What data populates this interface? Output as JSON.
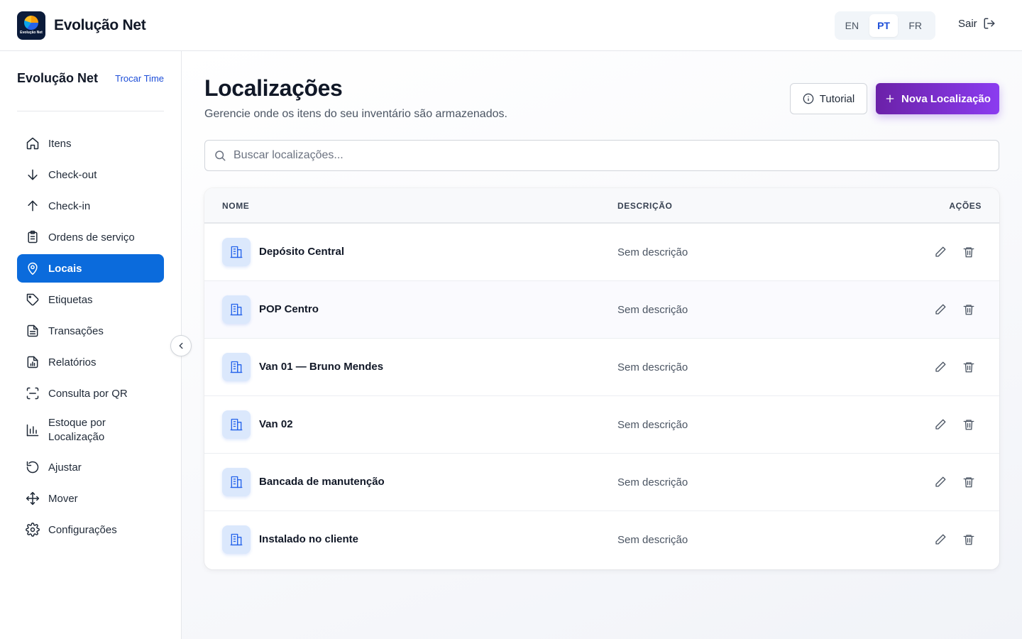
{
  "header": {
    "brand_name": "Evolução Net",
    "logo_text": "Evolução Net",
    "languages": [
      "EN",
      "PT",
      "FR"
    ],
    "active_language": "PT",
    "logout_label": "Sair"
  },
  "sidebar": {
    "team_name": "Evolução Net",
    "switch_team_label": "Trocar Time",
    "active_item": "Locais",
    "items": [
      {
        "label": "Itens",
        "icon": "home-icon"
      },
      {
        "label": "Check-out",
        "icon": "arrow-down-icon"
      },
      {
        "label": "Check-in",
        "icon": "arrow-up-icon"
      },
      {
        "label": "Ordens de serviço",
        "icon": "clipboard-icon"
      },
      {
        "label": "Locais",
        "icon": "map-pin-icon"
      },
      {
        "label": "Etiquetas",
        "icon": "tag-icon"
      },
      {
        "label": "Transações",
        "icon": "document-icon"
      },
      {
        "label": "Relatórios",
        "icon": "report-icon"
      },
      {
        "label": "Consulta por QR",
        "icon": "scan-icon"
      },
      {
        "label": "Estoque por Localização",
        "icon": "bar-chart-icon"
      },
      {
        "label": "Ajustar",
        "icon": "rotate-icon"
      },
      {
        "label": "Mover",
        "icon": "move-icon"
      },
      {
        "label": "Configurações",
        "icon": "gear-icon"
      }
    ]
  },
  "main": {
    "title": "Localizações",
    "subtitle": "Gerencie onde os itens do seu inventário são armazenados.",
    "tutorial_label": "Tutorial",
    "new_label": "Nova Localização",
    "search_placeholder": "Buscar localizações...",
    "accent_color": "#0b6bdc",
    "primary_button_color": "#7c3aed"
  },
  "table": {
    "headers": {
      "name": "NOME",
      "description": "DESCRIÇÃO",
      "actions": "AÇÕES"
    },
    "rows": [
      {
        "name": "Depósito Central",
        "description": "Sem descrição"
      },
      {
        "name": "POP Centro",
        "description": "Sem descrição"
      },
      {
        "name": "Van 01 — Bruno Mendes",
        "description": "Sem descrição"
      },
      {
        "name": "Van 02",
        "description": "Sem descrição"
      },
      {
        "name": "Bancada de manutenção",
        "description": "Sem descrição"
      },
      {
        "name": "Instalado no cliente",
        "description": "Sem descrição"
      }
    ]
  }
}
